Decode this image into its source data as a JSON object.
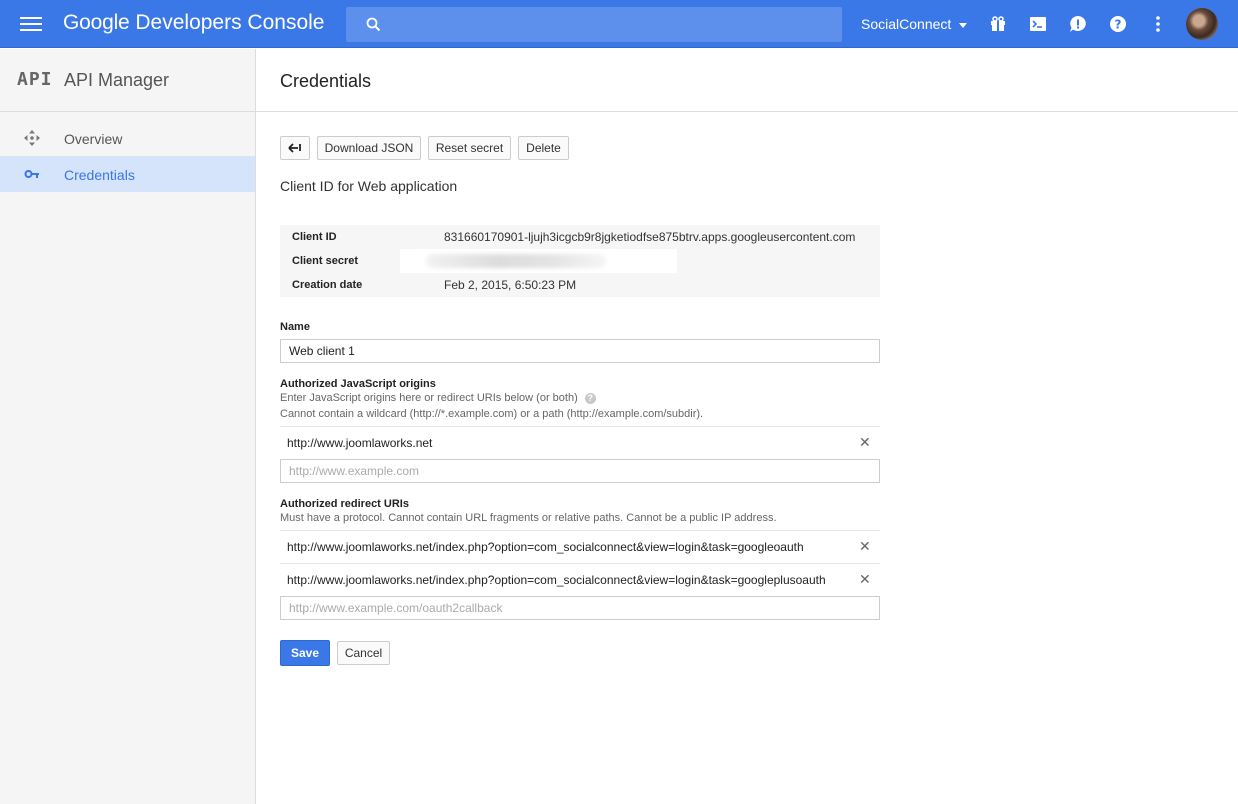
{
  "header": {
    "app_brand": "Google",
    "app_title": "Developers Console",
    "search_placeholder": "",
    "project_name": "SocialConnect"
  },
  "sidebar": {
    "badge": "API",
    "title": "API Manager",
    "items": [
      {
        "label": "Overview",
        "icon": "overview-icon",
        "active": false
      },
      {
        "label": "Credentials",
        "icon": "key-icon",
        "active": true
      }
    ]
  },
  "page": {
    "title": "Credentials",
    "toolbar": {
      "download": "Download JSON",
      "reset": "Reset secret",
      "delete": "Delete"
    },
    "subtitle": "Client ID for Web application",
    "info": {
      "client_id_label": "Client ID",
      "client_id": "831660170901-ljujh3icgcb9r8jgketiodfse875btrv.apps.googleusercontent.com",
      "client_secret_label": "Client secret",
      "creation_label": "Creation date",
      "creation_date": "Feb 2, 2015, 6:50:23 PM"
    },
    "name": {
      "label": "Name",
      "value": "Web client 1"
    },
    "js_origins": {
      "label": "Authorized JavaScript origins",
      "hint1": "Enter JavaScript origins here or redirect URIs below (or both)",
      "hint2": "Cannot contain a wildcard (http://*.example.com) or a path (http://example.com/subdir).",
      "items": [
        "http://www.joomlaworks.net"
      ],
      "placeholder": "http://www.example.com"
    },
    "redirect_uris": {
      "label": "Authorized redirect URIs",
      "hint": "Must have a protocol. Cannot contain URL fragments or relative paths. Cannot be a public IP address.",
      "items": [
        "http://www.joomlaworks.net/index.php?option=com_socialconnect&view=login&task=googleoauth",
        "http://www.joomlaworks.net/index.php?option=com_socialconnect&view=login&task=googleplusoauth"
      ],
      "placeholder": "http://www.example.com/oauth2callback"
    },
    "save": "Save",
    "cancel": "Cancel"
  },
  "colors": {
    "topbar": "#3b78e7",
    "search": "#5c90ec",
    "active_nav_bg": "#d5e3fb",
    "accent": "#3b78e7"
  }
}
